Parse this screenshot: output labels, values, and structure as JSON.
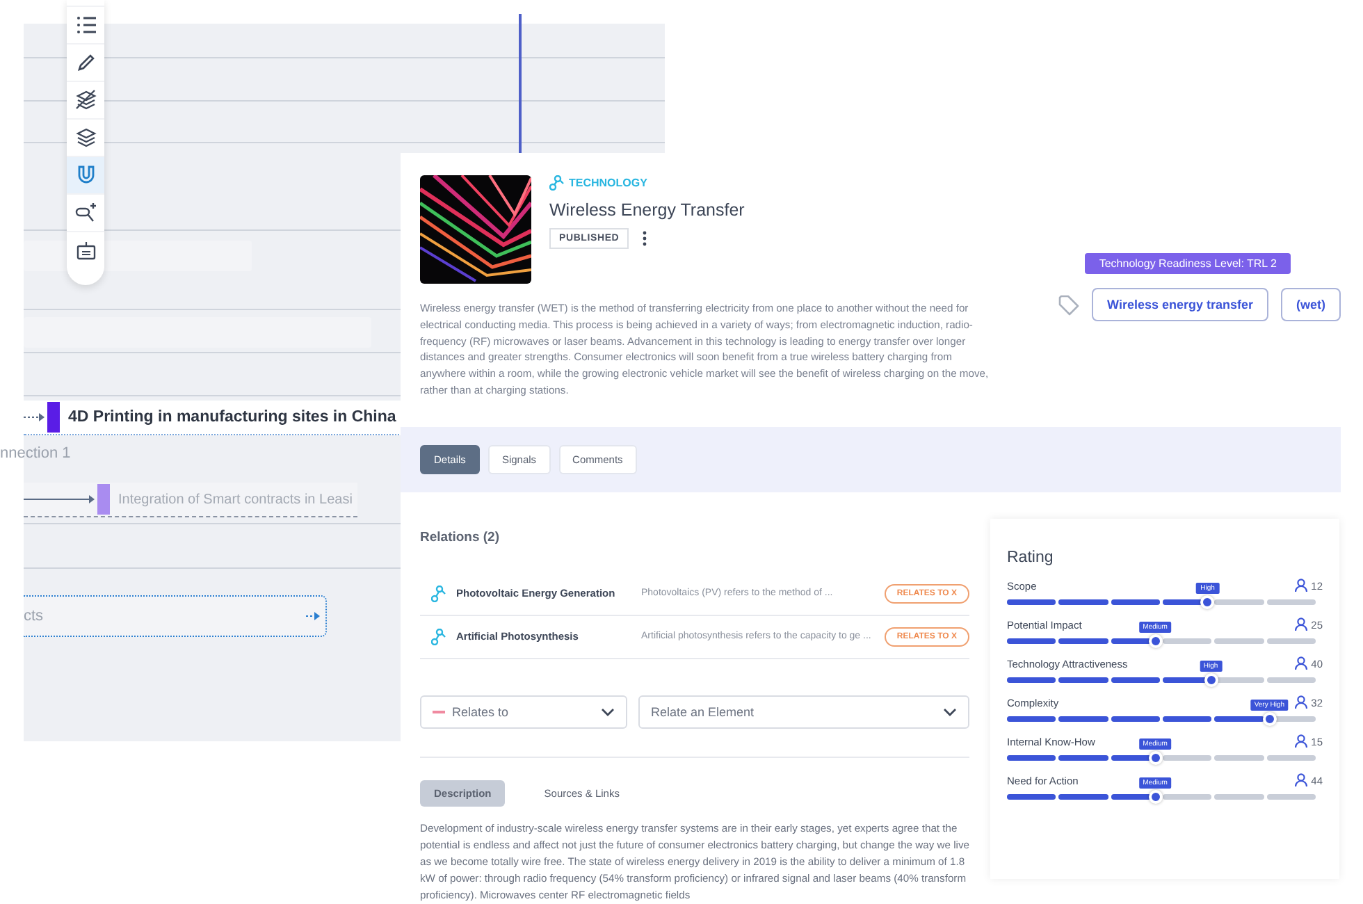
{
  "canvas": {
    "toolbar": [
      {
        "kind": "list",
        "selected": false
      },
      {
        "kind": "pencil",
        "selected": false
      },
      {
        "kind": "layers-off",
        "selected": false
      },
      {
        "kind": "layers",
        "selected": false
      },
      {
        "kind": "magnet",
        "selected": true
      },
      {
        "kind": "search-add",
        "selected": false
      },
      {
        "kind": "robot",
        "selected": false
      }
    ],
    "items": [
      {
        "kind": "node",
        "text": "4D Printing in manufacturing sites in China",
        "color": "#5a1de6"
      },
      {
        "kind": "label",
        "text": "nnection 1"
      },
      {
        "kind": "node-faded",
        "text": "Integration of Smart contracts in Leasi",
        "color": "#a98cf0"
      },
      {
        "kind": "group",
        "text": "cts"
      }
    ]
  },
  "panel": {
    "category": "TECHNOLOGY",
    "title": "Wireless Energy Transfer",
    "status": "PUBLISHED",
    "summary": "Wireless energy transfer (WET) is the method of transferring electricity from one place to another without the need for electrical conducting media. This process is being achieved in a variety of ways; from electromagnetic induction, radio-frequency (RF) microwaves or laser beams. Advancement in this technology is leading to energy transfer over longer distances and greater strengths. Consumer electronics will soon benefit from a true wireless battery charging from anywhere within a room, while the growing electronic vehicle market will see the benefit of wireless charging on the move, rather than at charging stations.",
    "readiness": "Technology Readiness Level: TRL 2",
    "tags": [
      "Wireless energy transfer",
      "(wet)"
    ],
    "tabs": [
      {
        "label": "Details",
        "selected": true
      },
      {
        "label": "Signals",
        "selected": false
      },
      {
        "label": "Comments",
        "selected": false
      }
    ],
    "relations_title": "Relations (2)",
    "relations": [
      {
        "name": "Photovoltaic Energy Generation",
        "summary": "Photovoltaics (PV) refers to the method of ...",
        "badge": "RELATES TO X"
      },
      {
        "name": "Artificial Photosynthesis",
        "summary": "Artificial photosynthesis refers to the capacity to ge ...",
        "badge": "RELATES TO X"
      }
    ],
    "selects": [
      {
        "placeholder": "Relates to",
        "kind": "relation"
      },
      {
        "placeholder": "Relate an Element",
        "kind": "element"
      }
    ],
    "subtabs": [
      {
        "label": "Description",
        "selected": true
      },
      {
        "label": "Sources & Links",
        "selected": false
      }
    ],
    "description": "Development of industry-scale wireless energy transfer systems are in their early stages, yet experts agree that the potential is endless and affect not just the future of consumer electronics battery charging, but change the way we live as we become totally wire free. The state of wireless energy delivery in 2019 is the ability to deliver a minimum of 1.8 kW of power: through radio frequency (54% transform proficiency) or infrared signal and laser beams (40% transform proficiency). Microwaves center RF electromagnetic fields",
    "rating": {
      "title": "Rating",
      "criteria": [
        {
          "name": "Scope",
          "badge": "High",
          "level": 0.65,
          "count": "12"
        },
        {
          "name": "Potential Impact",
          "badge": "Medium",
          "level": 0.48,
          "count": "25"
        },
        {
          "name": "Technology Attractiveness",
          "badge": "High",
          "level": 0.66,
          "count": "40"
        },
        {
          "name": "Complexity",
          "badge": "Very High",
          "level": 0.85,
          "count": "32"
        },
        {
          "name": "Internal Know-How",
          "badge": "Medium",
          "level": 0.48,
          "count": "15"
        },
        {
          "name": "Need for Action",
          "badge": "Medium",
          "level": 0.48,
          "count": "44"
        }
      ]
    }
  }
}
